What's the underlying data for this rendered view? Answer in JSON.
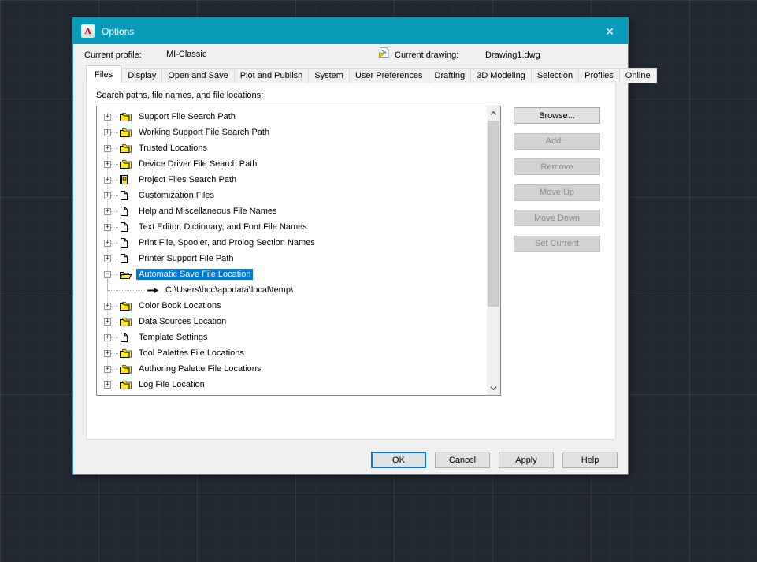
{
  "window": {
    "title": "Options",
    "close_glyph": "✕",
    "app_initial": "A"
  },
  "header": {
    "profile_label": "Current profile:",
    "profile_value": "MI-Classic",
    "drawing_label": "Current drawing:",
    "drawing_value": "Drawing1.dwg"
  },
  "tabs": [
    {
      "label": "Files",
      "active": true
    },
    {
      "label": "Display"
    },
    {
      "label": "Open and Save"
    },
    {
      "label": "Plot and Publish"
    },
    {
      "label": "System"
    },
    {
      "label": "User Preferences"
    },
    {
      "label": "Drafting"
    },
    {
      "label": "3D Modeling"
    },
    {
      "label": "Selection"
    },
    {
      "label": "Profiles"
    },
    {
      "label": "Online"
    }
  ],
  "files_tab": {
    "section_label": "Search paths, file names, and file locations:",
    "tree": [
      {
        "label": "Support File Search Path",
        "icon": "folders",
        "expanded": false
      },
      {
        "label": "Working Support File Search Path",
        "icon": "folders",
        "expanded": false
      },
      {
        "label": "Trusted Locations",
        "icon": "folders",
        "expanded": false
      },
      {
        "label": "Device Driver File Search Path",
        "icon": "folders",
        "expanded": false
      },
      {
        "label": "Project Files Search Path",
        "icon": "book",
        "expanded": false
      },
      {
        "label": "Customization Files",
        "icon": "file",
        "expanded": false
      },
      {
        "label": "Help and Miscellaneous File Names",
        "icon": "file",
        "expanded": false
      },
      {
        "label": "Text Editor, Dictionary, and Font File Names",
        "icon": "file",
        "expanded": false
      },
      {
        "label": "Print File, Spooler, and Prolog Section Names",
        "icon": "file",
        "expanded": false
      },
      {
        "label": "Printer Support File Path",
        "icon": "file",
        "expanded": false
      },
      {
        "label": "Automatic Save File Location",
        "icon": "open_folder",
        "expanded": true,
        "selected": true,
        "children": [
          {
            "label": "C:\\Users\\hcc\\appdata\\local\\temp\\",
            "icon": "arrow"
          }
        ]
      },
      {
        "label": "Color Book Locations",
        "icon": "folders",
        "expanded": false
      },
      {
        "label": "Data Sources Location",
        "icon": "folders",
        "expanded": false
      },
      {
        "label": "Template Settings",
        "icon": "file",
        "expanded": false
      },
      {
        "label": "Tool Palettes File Locations",
        "icon": "folders",
        "expanded": false
      },
      {
        "label": "Authoring Palette File Locations",
        "icon": "folders",
        "expanded": false
      },
      {
        "label": "Log File Location",
        "icon": "folders",
        "expanded": false
      }
    ]
  },
  "side_buttons": [
    {
      "label": "Browse...",
      "enabled": true
    },
    {
      "label": "Add...",
      "enabled": false
    },
    {
      "label": "Remove",
      "enabled": false
    },
    {
      "label": "Move Up",
      "enabled": false
    },
    {
      "label": "Move Down",
      "enabled": false
    },
    {
      "label": "Set Current",
      "enabled": false
    }
  ],
  "bottom_buttons": [
    {
      "label": "OK",
      "default": true
    },
    {
      "label": "Cancel"
    },
    {
      "label": "Apply"
    },
    {
      "label": "Help"
    }
  ],
  "colors": {
    "titlebar_teal": "#0a9aba",
    "selection_blue": "#0078d7",
    "folder_yellow": "#ffe92a",
    "canvas_background": "#222831",
    "dialog_body": "#f0f0f0"
  }
}
